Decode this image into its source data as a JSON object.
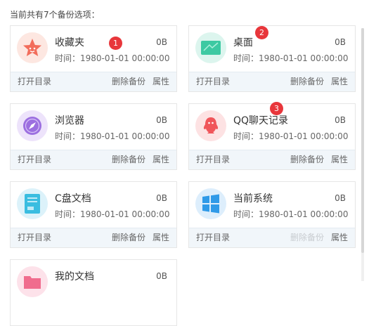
{
  "header": {
    "text": "当前共有7个备份选项："
  },
  "cards": [
    {
      "name": "收藏夹",
      "size": "0B",
      "time": "时间：1980-01-01 00:00:00",
      "open": "打开目录",
      "delete": "删除备份",
      "props": "属性",
      "badge": "1",
      "icon": "star-icon",
      "color": "#f26d5b"
    },
    {
      "name": "桌面",
      "size": "0B",
      "time": "时间：1980-01-01 00:00:00",
      "open": "打开目录",
      "delete": "删除备份",
      "props": "属性",
      "badge": "2",
      "icon": "desktop-icon",
      "color": "#3cc9a2"
    },
    {
      "name": "浏览器",
      "size": "0B",
      "time": "时间：1980-01-01 00:00:00",
      "open": "打开目录",
      "delete": "删除备份",
      "props": "属性",
      "icon": "compass-icon",
      "color": "#9c6fe0"
    },
    {
      "name": "QQ聊天记录",
      "size": "0B",
      "time": "时间：1980-01-01 00:00:00",
      "open": "打开目录",
      "delete": "删除备份",
      "props": "属性",
      "badge": "3",
      "icon": "qq-icon",
      "color": "#f0555a"
    },
    {
      "name": "C盘文档",
      "size": "0B",
      "time": "时间：1980-01-01 00:00:00",
      "open": "打开目录",
      "delete": "删除备份",
      "props": "属性",
      "icon": "document-icon",
      "color": "#39bde0"
    },
    {
      "name": "当前系统",
      "size": "0B",
      "time": "时间：1980-01-01 00:00:00",
      "open": "打开目录",
      "delete": "删除备份",
      "props": "属性",
      "icon": "windows-icon",
      "color": "#2f9ae8",
      "delete_disabled": true
    },
    {
      "name": "我的文档",
      "size": "0B",
      "icon": "folder-icon",
      "color": "#f06c8e"
    }
  ]
}
